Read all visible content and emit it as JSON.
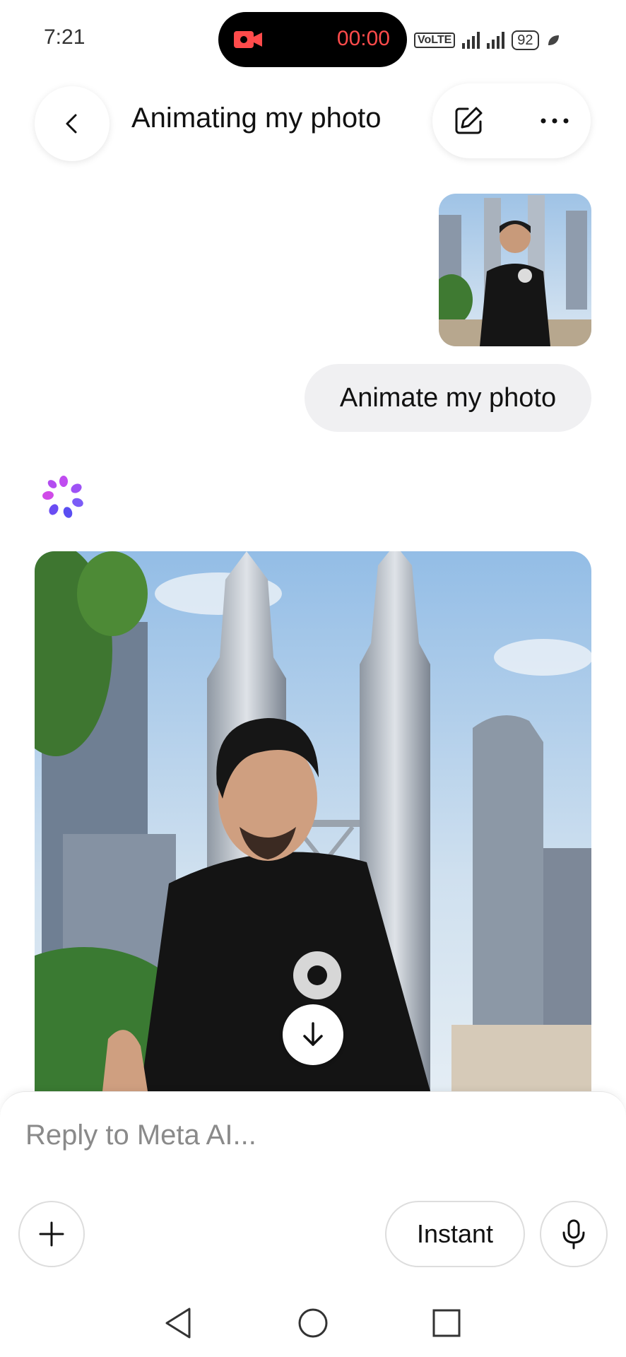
{
  "status_bar": {
    "time": "7:21",
    "recording_timer": "00:00",
    "network": "VoLTE",
    "battery": "92",
    "record_color": "#ff4b4b"
  },
  "header": {
    "title": "Animating my photo",
    "back_icon": "chevron-left-icon",
    "edit_icon": "edit-icon",
    "more_icon": "more-horizontal-icon"
  },
  "chat": {
    "user_message": "Animate my photo",
    "ai_icon": "meta-ai-logo",
    "download_icon": "download-arrow-icon"
  },
  "composer": {
    "placeholder": "Reply to Meta AI...",
    "mode_label": "Instant",
    "add_icon": "plus-icon",
    "mic_icon": "mic-icon"
  },
  "nav": {
    "back": "triangle-back-icon",
    "home": "circle-home-icon",
    "recents": "square-recents-icon"
  }
}
